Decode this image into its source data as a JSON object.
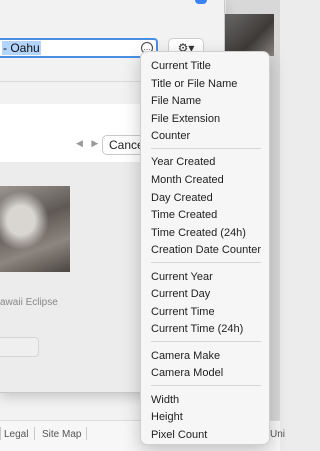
{
  "dialog": {
    "filename_prefix": "- Oahu",
    "field_tokens_glyph": "…",
    "token_button_glyph": "⚙︎▾",
    "nav_arrows": "◀ ▶",
    "cancel_label": "Cancel",
    "photo_caption": "awaii Eclipse"
  },
  "footer": {
    "links": [
      "Legal",
      "Site Map"
    ],
    "edge_text": "Uni"
  },
  "menu": {
    "groups": [
      [
        "Current Title",
        "Title or File Name",
        "File Name",
        "File Extension",
        "Counter"
      ],
      [
        "Year Created",
        "Month Created",
        "Day Created",
        "Time Created",
        "Time Created (24h)",
        "Creation Date Counter"
      ],
      [
        "Current Year",
        "Current Day",
        "Current Time",
        "Current Time (24h)"
      ],
      [
        "Camera Make",
        "Camera Model"
      ],
      [
        "Width",
        "Height",
        "Pixel Count"
      ]
    ]
  }
}
